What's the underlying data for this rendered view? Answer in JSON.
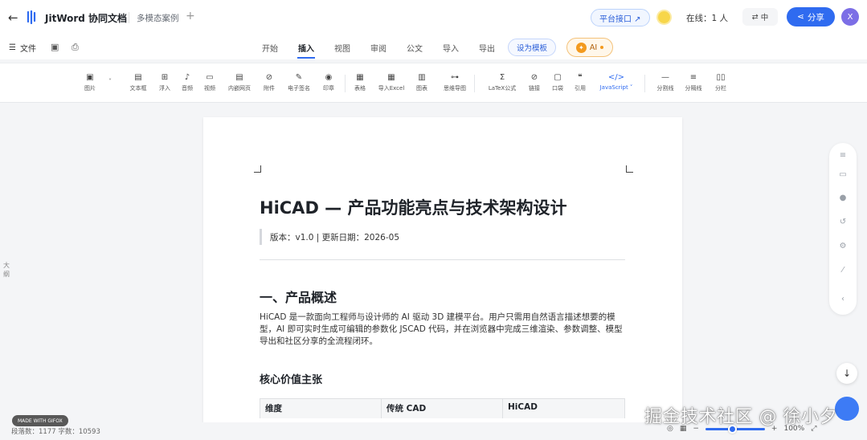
{
  "header": {
    "back_icon": "arrow-left-icon",
    "app_title": "JitWord 协同文档",
    "doc_tab": "多模态案例",
    "add_tab": "+",
    "platform_btn": "平台接口 ↗",
    "online": "在线：1 人",
    "lang": "中",
    "share": "分享",
    "avatar": "X"
  },
  "menu": {
    "file": "文件",
    "tabs": [
      "开始",
      "插入",
      "视图",
      "审阅",
      "公文",
      "导入",
      "导出"
    ],
    "active_tab": "插入",
    "template_btn": "设为模板",
    "ai_btn": "AI"
  },
  "ribbon": {
    "tools": [
      {
        "label": "图片",
        "glyph": "▣"
      },
      {
        "label": "文本框",
        "glyph": "▤"
      },
      {
        "label": "浮入",
        "glyph": "⊞"
      },
      {
        "label": "音频",
        "glyph": "♪"
      },
      {
        "label": "视频",
        "glyph": "▭"
      },
      {
        "label": "内嵌网页",
        "glyph": "▤"
      },
      {
        "label": "附件",
        "glyph": "⊘"
      },
      {
        "label": "电子签名",
        "glyph": "✎"
      },
      {
        "label": "印章",
        "glyph": "◉"
      },
      {
        "label": "表格",
        "glyph": "▦"
      },
      {
        "label": "导入Excel",
        "glyph": "▦"
      },
      {
        "label": "图表",
        "glyph": "▥"
      },
      {
        "label": "思维导图",
        "glyph": "⊶"
      },
      {
        "label": "LaTeX公式",
        "glyph": "Σ"
      },
      {
        "label": "链接",
        "glyph": "⊘"
      },
      {
        "label": "口袋",
        "glyph": "▢"
      },
      {
        "label": "引用",
        "glyph": "❝"
      },
      {
        "label": "JavaScript ˅",
        "glyph": "</>"
      },
      {
        "label": "分割线",
        "glyph": "—"
      },
      {
        "label": "分隔线",
        "glyph": "≡"
      },
      {
        "label": "分栏",
        "glyph": "▯▯"
      }
    ]
  },
  "document": {
    "title": "HiCAD — 产品功能亮点与技术架构设计",
    "version": "版本：v1.0 | 更新日期：2026-05",
    "section1": "一、产品概述",
    "paragraph": "HiCAD 是一款面向工程师与设计师的 AI 驱动 3D 建模平台。用户只需用自然语言描述想要的模型，AI 即可实时生成可编辑的参数化 JSCAD 代码，并在浏览器中完成三维渲染、参数调整、模型导出和社区分享的全流程闭环。",
    "subsection": "核心价值主张",
    "table_headers": [
      "维度",
      "传统 CAD",
      "HiCAD"
    ]
  },
  "sidebar_left": {
    "outline": "大纲"
  },
  "status": {
    "text": "段落数：1177  字数：10593",
    "zoom": "100%",
    "zoom_fraction": 0.45,
    "gifox": "MADE WITH GIFOX",
    "watermark": "掘金技术社区 @ 徐小夕"
  },
  "colors": {
    "accent": "#2f6bf0",
    "ai": "#f39a1e"
  }
}
